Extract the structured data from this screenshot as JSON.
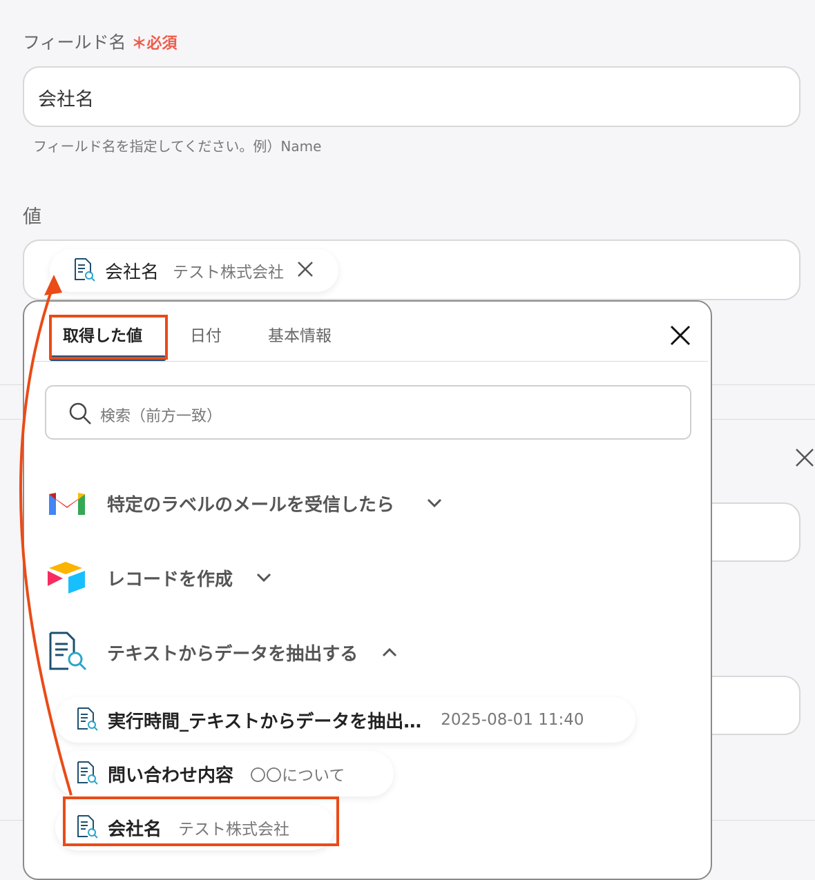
{
  "field_name": {
    "label": "フィールド名",
    "required": "必須",
    "value": "会社名",
    "hint": "フィールド名を指定してください。例）Name"
  },
  "value_field": {
    "label": "値",
    "chip": {
      "name": "会社名",
      "value": "テスト株式会社"
    }
  },
  "panel": {
    "tabs": [
      "取得した値",
      "日付",
      "基本情報"
    ],
    "search_placeholder": "検索（前方一致）",
    "sections": [
      {
        "title": "特定のラベルのメールを受信したら",
        "icon": "gmail-icon",
        "state": "collapsed"
      },
      {
        "title": "レコードを作成",
        "icon": "airtable-icon",
        "state": "collapsed"
      },
      {
        "title": "テキストからデータを抽出する",
        "icon": "document-search-icon",
        "state": "expanded"
      }
    ],
    "items": [
      {
        "name": "実行時間_テキストからデータを抽出…",
        "value": "2025-08-01 11:40"
      },
      {
        "name": "問い合わせ内容",
        "value": "〇〇について"
      },
      {
        "name": "会社名",
        "value": "テスト株式会社"
      }
    ]
  },
  "colors": {
    "accent_red": "#ea4b17",
    "required_red": "#f05a4a",
    "tab_indicator": "#1f4e79"
  }
}
